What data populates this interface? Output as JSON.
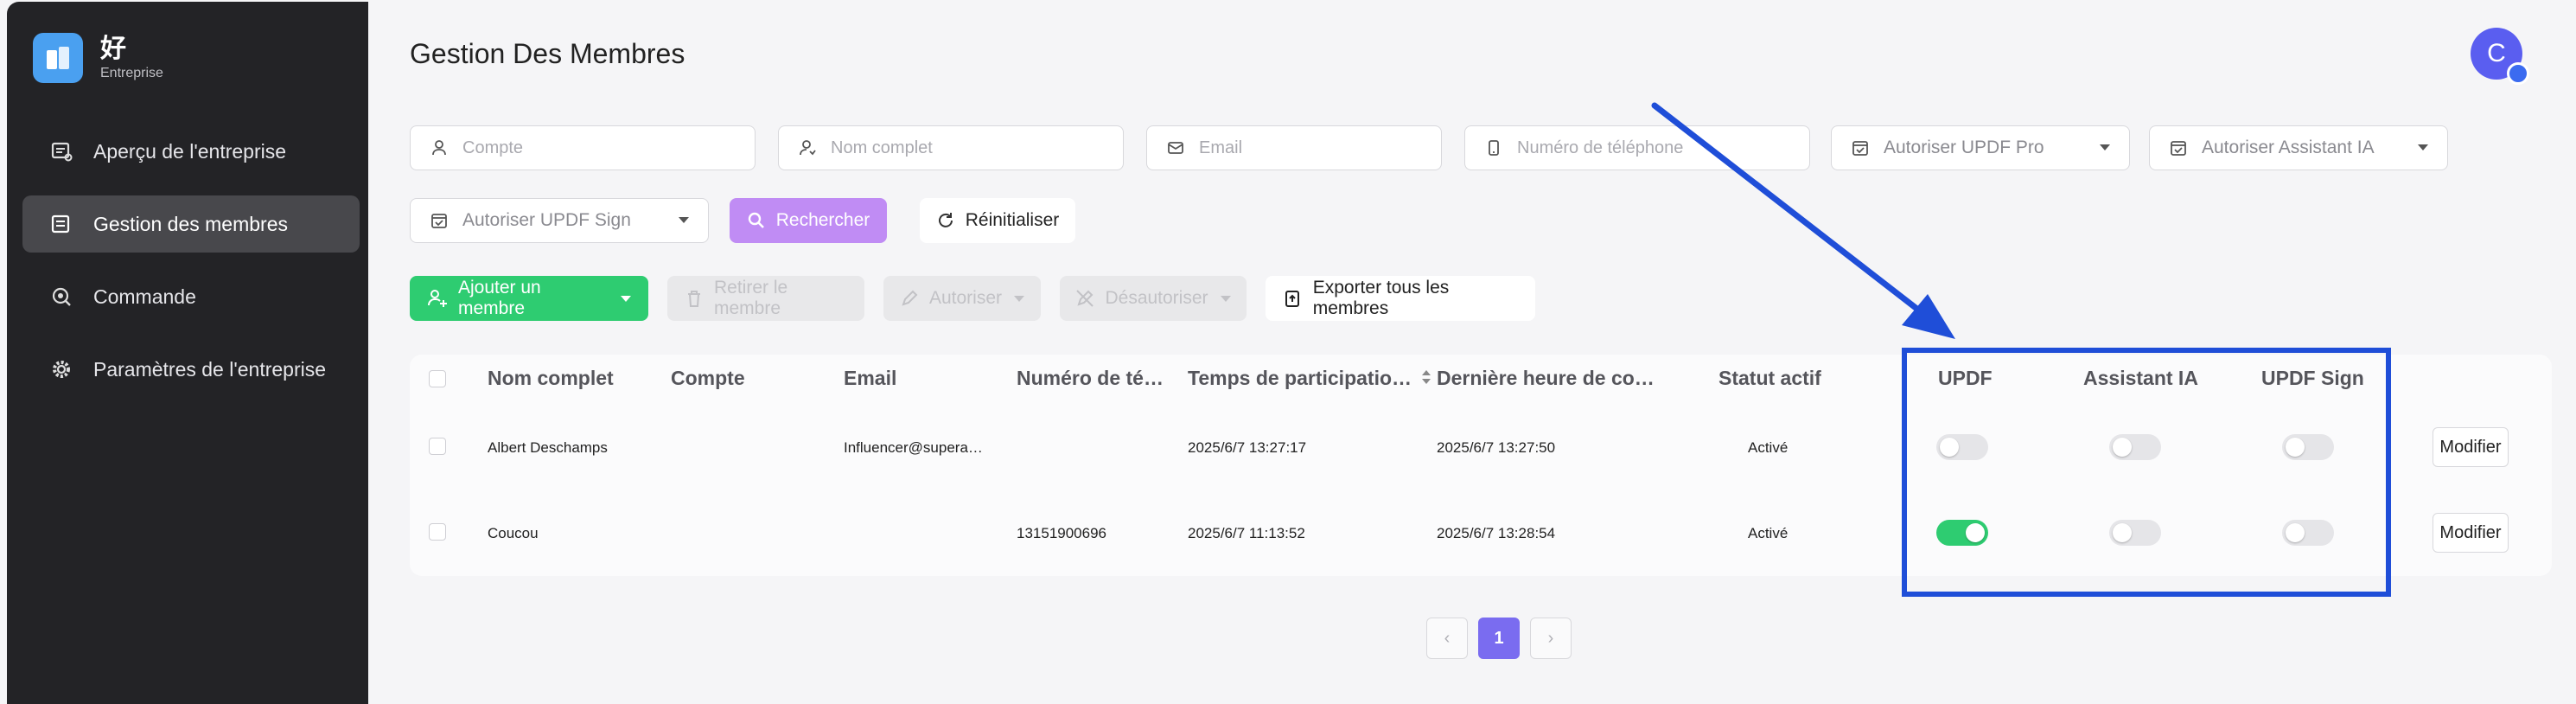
{
  "brand": {
    "name": "好",
    "subtitle": "Entreprise"
  },
  "sidebar": {
    "items": [
      {
        "label": "Aperçu de l'entreprise",
        "icon": "overview-icon",
        "active": false
      },
      {
        "label": "Gestion des membres",
        "icon": "members-icon",
        "active": true
      },
      {
        "label": "Commande",
        "icon": "order-icon",
        "active": false
      },
      {
        "label": "Paramètres de l'entreprise",
        "icon": "gear-icon",
        "active": false
      }
    ]
  },
  "header": {
    "title": "Gestion Des Membres",
    "avatar_letter": "C"
  },
  "filters": {
    "account_placeholder": "Compte",
    "fullname_placeholder": "Nom complet",
    "email_placeholder": "Email",
    "phone_placeholder": "Numéro de téléphone",
    "pro_select": "Autoriser UPDF Pro",
    "ai_select": "Autoriser Assistant IA",
    "sign_select": "Autoriser UPDF Sign",
    "search_label": "Rechercher",
    "reset_label": "Réinitialiser"
  },
  "actions": {
    "add_label": "Ajouter un membre",
    "remove_label": "Retirer le membre",
    "authorize_label": "Autoriser",
    "deauthorize_label": "Désautoriser",
    "export_label": "Exporter tous les membres"
  },
  "table": {
    "columns": [
      "Nom complet",
      "Compte",
      "Email",
      "Numéro de té…",
      "Temps de participatio…",
      "Dernière heure de co…",
      "Statut actif",
      "UPDF",
      "Assistant IA",
      "UPDF Sign"
    ],
    "rows": [
      {
        "name": "Albert Deschamps",
        "account": "",
        "email": "Influencer@supera…",
        "phone": "",
        "joined": "2025/6/7 13:27:17",
        "last_login": "2025/6/7 13:27:50",
        "status": "Activé",
        "updf": false,
        "ai": false,
        "sign": false,
        "edit": "Modifier"
      },
      {
        "name": "Coucou",
        "account": "",
        "email": "",
        "phone": "13151900696",
        "joined": "2025/6/7 11:13:52",
        "last_login": "2025/6/7 13:28:54",
        "status": "Activé",
        "updf": true,
        "ai": false,
        "sign": false,
        "edit": "Modifier"
      }
    ]
  },
  "pagination": {
    "prev": "‹",
    "current": "1",
    "next": "›"
  },
  "colors": {
    "accent_green": "#2ecc71",
    "search_purple": "#c08cf4",
    "highlight_blue": "#1f4ed8",
    "page_active": "#7a6cf0"
  }
}
